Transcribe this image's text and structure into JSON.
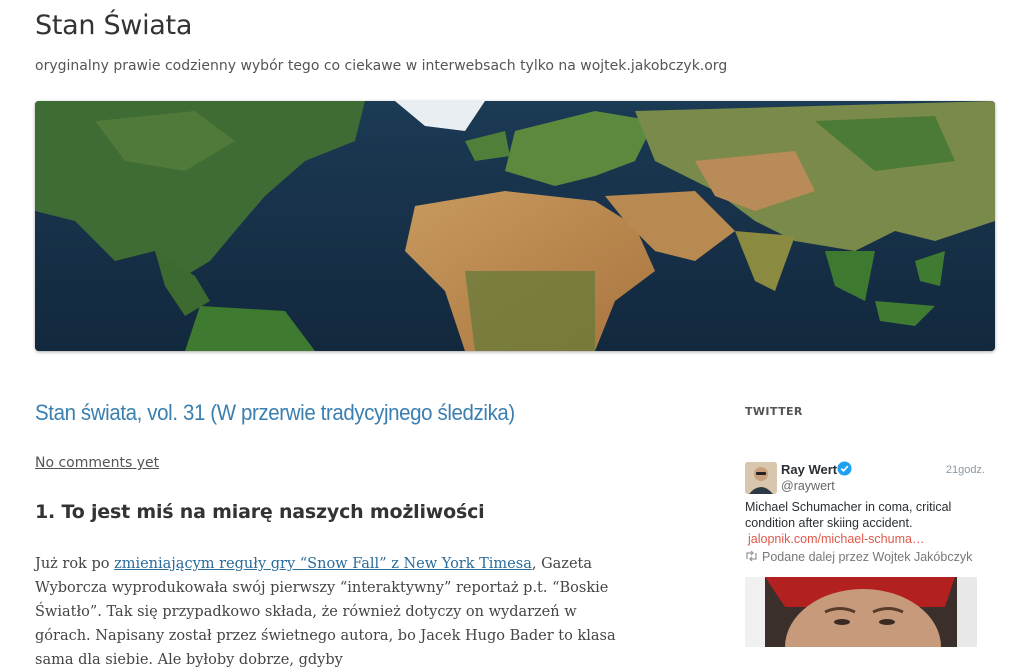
{
  "site": {
    "title": "Stan Świata",
    "tagline": "oryginalny prawie codzienny wybór tego co ciekawe w interwebsach tylko na wojtek.jakobczyk.org"
  },
  "banner": {
    "image_icon": "world-map-satellite"
  },
  "post": {
    "title": "Stan świata, vol. 31 (W przerwie tradycyjnego śledzika)",
    "comments_link": "No comments yet",
    "section_heading": "1. To jest miś na miarę naszych możliwości",
    "paragraph_prefix": "Już rok po ",
    "paragraph_link": "zmieniającym reguły gry “Snow Fall” z New York Timesa",
    "paragraph_rest": ", Gazeta Wyborcza wyprodukowała swój pierwszy “interaktywny” reportaż p.t. “Boskie Światło”. Tak się przypadkowo składa, że również dotyczy on wydarzeń w górach. Napisany został przez świetnego autora, bo Jacek Hugo Bader to klasa sama dla siebie. Ale byłoby dobrze, gdyby"
  },
  "sidebar": {
    "widget_title": "TWITTER",
    "tweet": {
      "name": "Ray Wert",
      "handle": "@raywert",
      "time": "21godz.",
      "text": "Michael Schumacher in coma, critical condition after skiing accident.",
      "link": "jalopnik.com/michael-schuma…",
      "retweet_prefix": "Podane dalej przez",
      "retweeter": "Wojtek Jakóbczyk",
      "verified_icon": "verified-badge-icon",
      "retweet_icon": "retweet-icon"
    }
  },
  "colors": {
    "link_blue": "#3a7fb0",
    "tweet_link_red": "#e0584a",
    "verified_blue": "#1da1f2"
  }
}
